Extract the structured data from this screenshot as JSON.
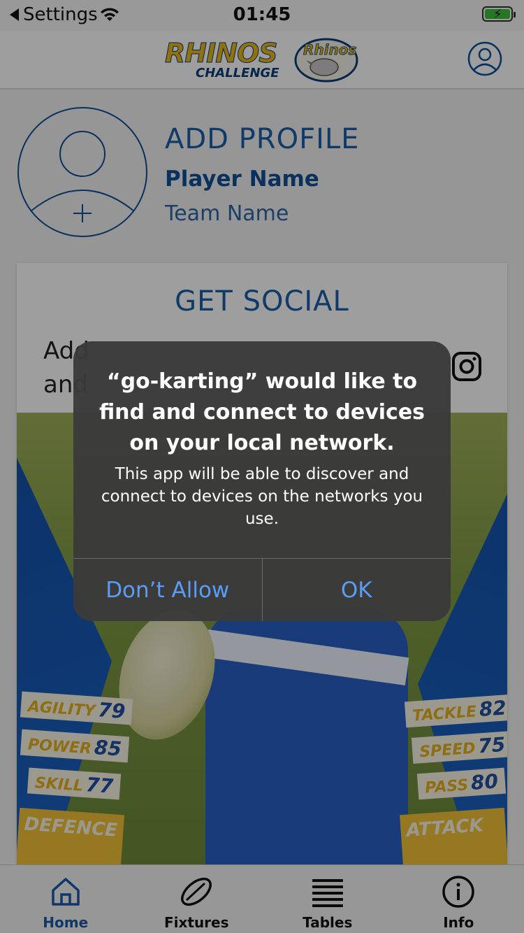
{
  "status_bar": {
    "back_label": "Settings",
    "time": "01:45"
  },
  "header": {
    "logo_main": "RHINOS",
    "logo_sub": "CHALLENGE"
  },
  "profile": {
    "title": "ADD PROFILE",
    "player_name": "Player Name",
    "team_name": "Team Name"
  },
  "social": {
    "title": "GET SOCIAL",
    "text_line1": "Add",
    "text_line2": "and"
  },
  "player_card": {
    "stats_left": [
      {
        "label": "AGILITY",
        "value": "79"
      },
      {
        "label": "POWER",
        "value": "85"
      },
      {
        "label": "SKILL",
        "value": "77"
      }
    ],
    "stats_right": [
      {
        "label": "TACKLE",
        "value": "82"
      },
      {
        "label": "SPEED",
        "value": "75"
      },
      {
        "label": "PASS",
        "value": "80"
      }
    ],
    "big_left": {
      "label": "DEFENCE"
    },
    "big_right": {
      "label": "ATTACK"
    }
  },
  "alert": {
    "title": "“go-karting” would like to find and connect to devices on your local network.",
    "message": "This app will be able to discover and connect to devices on the networks you use.",
    "deny_label": "Don’t Allow",
    "ok_label": "OK"
  },
  "tabs": [
    {
      "label": "Home",
      "icon": "home-icon",
      "active": true
    },
    {
      "label": "Fixtures",
      "icon": "rugby-ball-icon",
      "active": false
    },
    {
      "label": "Tables",
      "icon": "table-lines-icon",
      "active": false
    },
    {
      "label": "Info",
      "icon": "info-icon",
      "active": false
    }
  ],
  "colors": {
    "brand_blue": "#1b5ea6",
    "brand_gold": "#e8b71a",
    "alert_button": "#5a9cf8"
  }
}
